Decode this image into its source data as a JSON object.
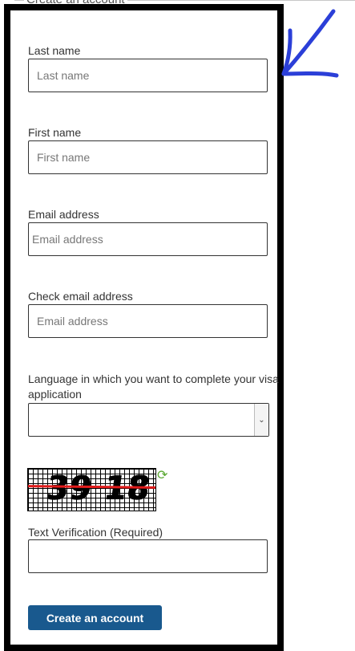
{
  "form": {
    "legend": "Create an account",
    "fields": [
      {
        "label": "Last name",
        "placeholder": "Last name"
      },
      {
        "label": "First name",
        "placeholder": "First name"
      },
      {
        "label": "Email address",
        "placeholder": "Email address"
      },
      {
        "label": "Check email address",
        "placeholder": "Email address"
      }
    ],
    "language": {
      "label": "Language in which you want to complete your visa application",
      "selected": ""
    },
    "captcha": {
      "text": "39 18",
      "verification_label": "Text Verification (Required)",
      "verification_value": ""
    },
    "submit_label": "Create an account"
  },
  "annotation": {
    "arrow_color": "#2b3fd8"
  },
  "colors": {
    "primary_button": "#19598e",
    "frame": "#000000",
    "captcha_strike": "#e21b1b",
    "refresh": "#5aa832"
  }
}
